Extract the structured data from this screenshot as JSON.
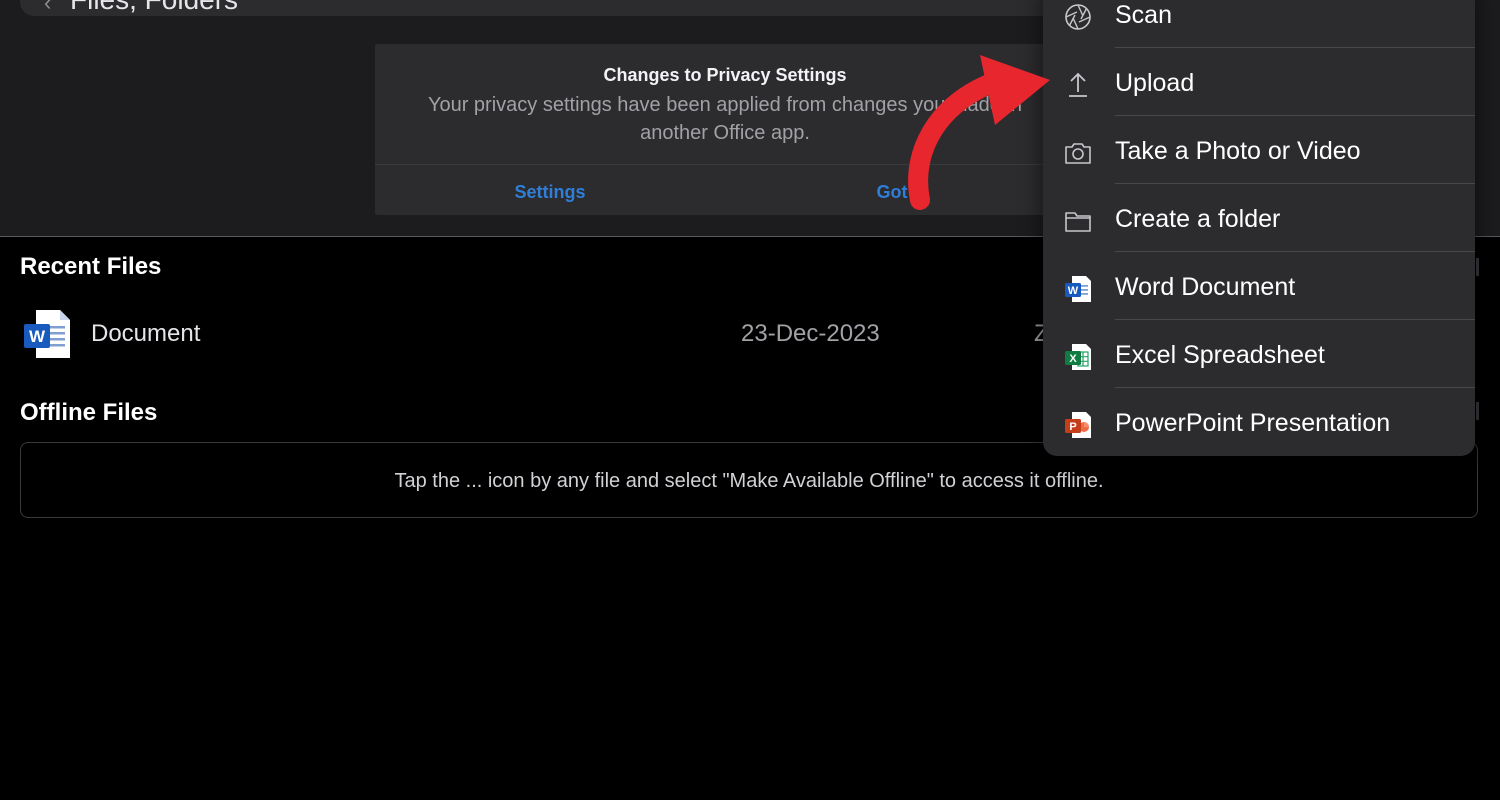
{
  "header": {
    "breadcrumb": "Files, Folders"
  },
  "privacy_banner": {
    "title": "Changes to Privacy Settings",
    "body": "Your privacy settings have been applied from changes you made in another Office app.",
    "settings_label": "Settings",
    "got_it_label": "Got It"
  },
  "recent": {
    "title": "Recent Files",
    "files": [
      {
        "name": "Document",
        "date": "23-Dec-2023",
        "location": "Z",
        "icon": "word-doc-icon"
      }
    ]
  },
  "offline": {
    "title": "Offline Files",
    "message": "Tap the ... icon by any file and select \"Make Available Offline\" to access it offline."
  },
  "create_menu": {
    "items": [
      {
        "label": "Scan",
        "icon": "aperture-icon"
      },
      {
        "label": "Upload",
        "icon": "upload-icon"
      },
      {
        "label": "Take a Photo or Video",
        "icon": "camera-icon"
      },
      {
        "label": "Create a folder",
        "icon": "folder-icon"
      },
      {
        "label": "Word Document",
        "icon": "word-icon"
      },
      {
        "label": "Excel Spreadsheet",
        "icon": "excel-icon"
      },
      {
        "label": "PowerPoint Presentation",
        "icon": "powerpoint-icon"
      }
    ]
  },
  "colors": {
    "accent_blue": "#2f7ed8",
    "annotation_red": "#e8262e",
    "word_blue": "#185abd",
    "excel_green": "#107c41",
    "powerpoint_orange": "#c43e1c"
  }
}
